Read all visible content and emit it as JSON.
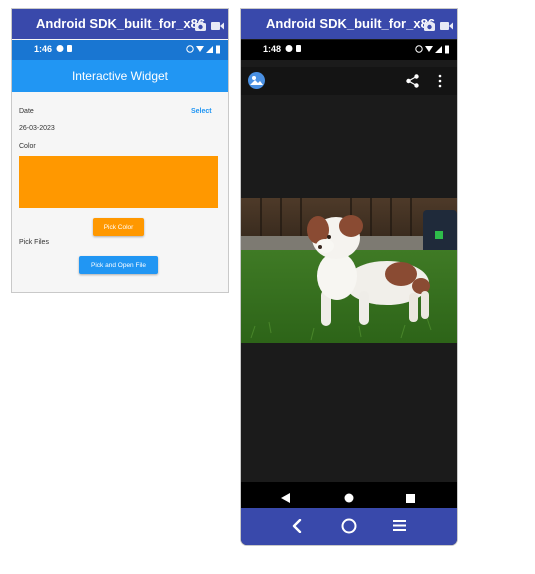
{
  "emulator_left": {
    "window_title": "Android SDK_built_for_x86",
    "status_time": "1:46",
    "app_title": "Interactive Widget",
    "date_label": "Date",
    "date_action": "Select",
    "date_value": "26-03-2023",
    "color_label": "Color",
    "selected_color": "#ff9800",
    "pick_color_button": "Pick Color",
    "pick_files_label": "Pick Files",
    "pick_open_button": "Pick and Open File"
  },
  "emulator_right": {
    "window_title": "Android SDK_built_for_x86",
    "status_time": "1:48",
    "photo_subject": "puppy on grass"
  },
  "colors": {
    "emulator_chrome": "#3949ab",
    "app_bar": "#2196f3",
    "accent": "#ff9800"
  },
  "icons": [
    "camera-icon",
    "video-icon",
    "gallery-app-icon",
    "share-icon",
    "overflow-menu-icon",
    "back-icon",
    "home-icon",
    "recents-icon"
  ]
}
